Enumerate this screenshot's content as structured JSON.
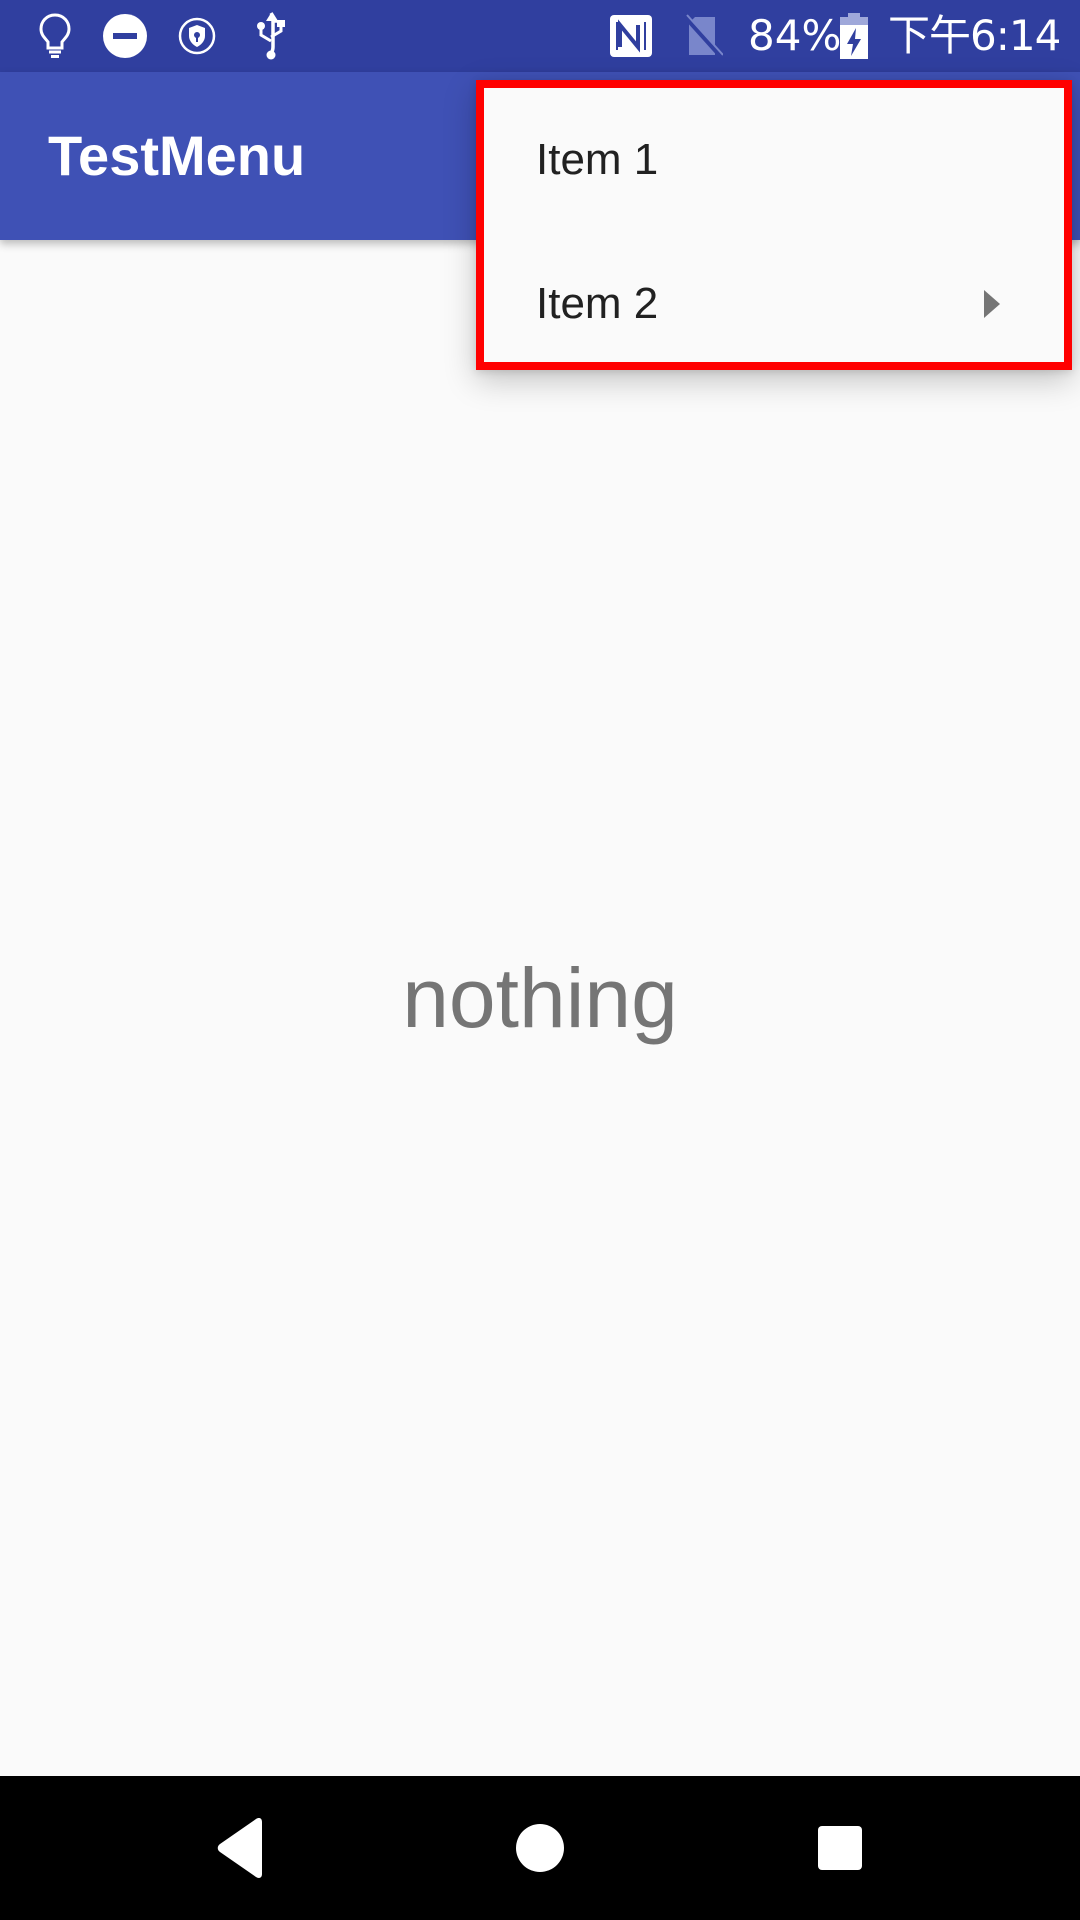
{
  "status_bar": {
    "left_icons": [
      "lightbulb-icon",
      "do-not-disturb-icon",
      "vpn-shield-icon",
      "usb-icon"
    ],
    "right_icons": [
      "nfc-icon",
      "no-sim-icon"
    ],
    "battery_percent": "84%",
    "battery_charging": true,
    "time": "下午6:14"
  },
  "app_bar": {
    "title": "TestMenu"
  },
  "menu": {
    "items": [
      {
        "label": "Item 1",
        "has_submenu": false
      },
      {
        "label": "Item 2",
        "has_submenu": true
      }
    ],
    "highlight_color": "#ff0000"
  },
  "content": {
    "text": "nothing"
  },
  "nav_bar": {
    "buttons": [
      "back-icon",
      "home-icon",
      "recents-icon"
    ]
  },
  "colors": {
    "status_bar": "#303f9f",
    "app_bar": "#3f51b5",
    "background": "#fafafa"
  }
}
